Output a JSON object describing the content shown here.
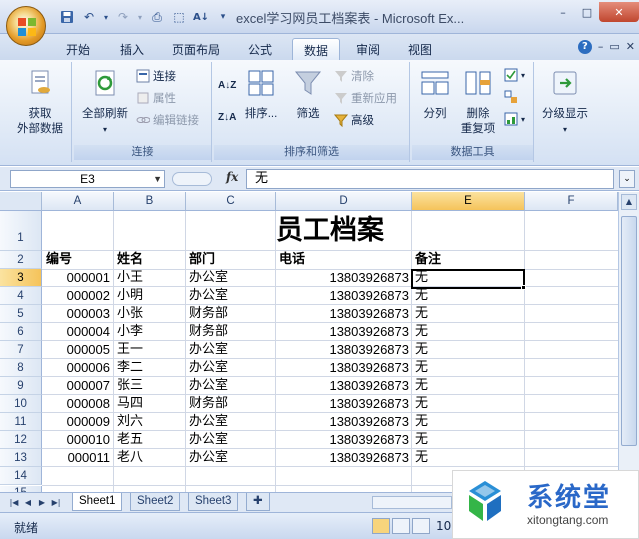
{
  "window": {
    "title": "excel学习网员工档案表 - Microsoft Ex...",
    "controls": [
      "–",
      "□",
      "✕"
    ]
  },
  "tabs": [
    {
      "label": "开始",
      "active": false
    },
    {
      "label": "插入",
      "active": false
    },
    {
      "label": "页面布局",
      "active": false
    },
    {
      "label": "公式",
      "active": false
    },
    {
      "label": "数据",
      "active": true
    },
    {
      "label": "审阅",
      "active": false
    },
    {
      "label": "视图",
      "active": false
    }
  ],
  "ribbon": {
    "get_external": {
      "line1": "获取",
      "line2": "外部数据"
    },
    "connections": {
      "refresh_all": "全部刷新",
      "connections": "连接",
      "properties": "属性",
      "edit_links": "编辑链接",
      "group_label": "连接"
    },
    "sort_filter": {
      "sort": "排序...",
      "filter": "筛选",
      "clear": "清除",
      "reapply": "重新应用",
      "advanced": "高级",
      "group_label": "排序和筛选"
    },
    "data_tools": {
      "text_to_columns": "分列",
      "remove_duplicates_1": "删除",
      "remove_duplicates_2": "重复项",
      "group_label": "数据工具"
    },
    "outline": {
      "label": "分级显示"
    }
  },
  "formula_bar": {
    "name_box": "E3",
    "fx": "fx",
    "value": "无"
  },
  "sheet": {
    "columns": [
      "A",
      "B",
      "C",
      "D",
      "E",
      "F"
    ],
    "selected_column": "E",
    "selected_row": 3,
    "rows": [
      "1",
      "2",
      "3",
      "4",
      "5",
      "6",
      "7",
      "8",
      "9",
      "10",
      "11",
      "12",
      "13",
      "14",
      "15"
    ],
    "title": "员工档案",
    "headers": {
      "id": "编号",
      "name": "姓名",
      "dept": "部门",
      "phone": "电话",
      "note": "备注"
    },
    "records": [
      {
        "id": "000001",
        "name": "小王",
        "dept": "办公室",
        "phone": "13803926873",
        "note": "无"
      },
      {
        "id": "000002",
        "name": "小明",
        "dept": "办公室",
        "phone": "13803926873",
        "note": "无"
      },
      {
        "id": "000003",
        "name": "小张",
        "dept": "财务部",
        "phone": "13803926873",
        "note": "无"
      },
      {
        "id": "000004",
        "name": "小李",
        "dept": "财务部",
        "phone": "13803926873",
        "note": "无"
      },
      {
        "id": "000005",
        "name": "王一",
        "dept": "办公室",
        "phone": "13803926873",
        "note": "无"
      },
      {
        "id": "000006",
        "name": "李二",
        "dept": "办公室",
        "phone": "13803926873",
        "note": "无"
      },
      {
        "id": "000007",
        "name": "张三",
        "dept": "办公室",
        "phone": "13803926873",
        "note": "无"
      },
      {
        "id": "000008",
        "name": "马四",
        "dept": "财务部",
        "phone": "13803926873",
        "note": "无"
      },
      {
        "id": "000009",
        "name": "刘六",
        "dept": "办公室",
        "phone": "13803926873",
        "note": "无"
      },
      {
        "id": "000010",
        "name": "老五",
        "dept": "办公室",
        "phone": "13803926873",
        "note": "无"
      },
      {
        "id": "000011",
        "name": "老八",
        "dept": "办公室",
        "phone": "13803926873",
        "note": "无"
      }
    ]
  },
  "sheet_tabs": [
    "Sheet1",
    "Sheet2",
    "Sheet3"
  ],
  "status": {
    "ready": "就绪",
    "zoom": "10"
  },
  "watermark": {
    "title": "系统堂",
    "url": "xitongtang.com"
  }
}
